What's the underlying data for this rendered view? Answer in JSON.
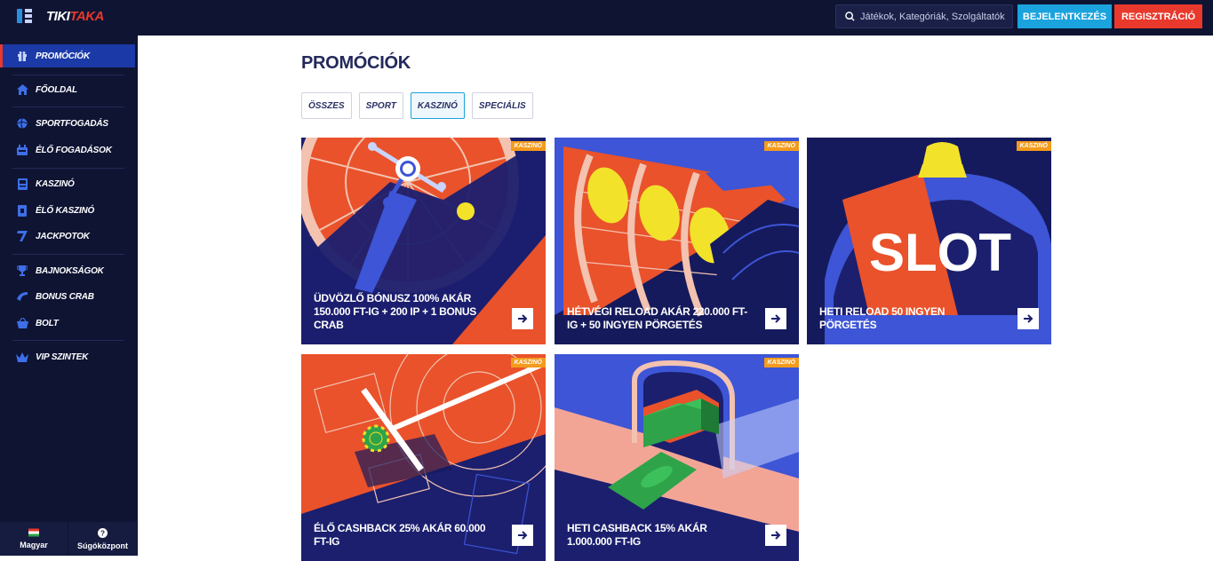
{
  "header": {
    "logo_part1": "TIKI",
    "logo_part2": "TAKA",
    "search_placeholder": "Játékok, Kategóriák, Szolgáltatók",
    "login_label": "BEJELENTKEZÉS",
    "register_label": "REGISZTRÁCIÓ"
  },
  "sidebar": {
    "items": [
      {
        "label": "PROMÓCIÓK",
        "icon": "gift-icon"
      },
      {
        "label": "FŐOLDAL",
        "icon": "home-icon"
      },
      {
        "label": "SPORTFOGADÁS",
        "icon": "ball-icon"
      },
      {
        "label": "ÉLŐ FOGADÁSOK",
        "icon": "live-icon"
      },
      {
        "label": "KASZINÓ",
        "icon": "casino-icon"
      },
      {
        "label": "ÉLŐ KASZINÓ",
        "icon": "card-icon"
      },
      {
        "label": "JACKPOTOK",
        "icon": "seven-icon"
      },
      {
        "label": "BAJNOKSÁGOK",
        "icon": "trophy-icon"
      },
      {
        "label": "BONUS CRAB",
        "icon": "crab-icon"
      },
      {
        "label": "BOLT",
        "icon": "basket-icon"
      },
      {
        "label": "VIP SZINTEK",
        "icon": "crown-icon"
      }
    ],
    "footer": {
      "language": "Magyar",
      "help": "Súgóközpont"
    }
  },
  "page": {
    "title": "PROMÓCIÓK",
    "filters": [
      "ÖSSZES",
      "SPORT",
      "KASZINÓ",
      "SPECIÁLIS"
    ],
    "active_filter": "KASZINÓ",
    "cards": [
      {
        "badge": "KASZINÓ",
        "title": "ÜDVÖZLŐ BÓNUSZ 100% AKÁR 150.000 FT-IG + 200 IP + 1 BONUS CRAB"
      },
      {
        "badge": "KASZINÓ",
        "title": "HÉTVÉGI RELOAD AKÁR 220.000 FT-IG + 50 INGYEN PÖRGETÉS"
      },
      {
        "badge": "KASZINÓ",
        "title": "HETI RELOAD 50 INGYEN PÖRGETÉS",
        "art_text": "SLOT"
      },
      {
        "badge": "KASZINÓ",
        "title": "ÉLŐ CASHBACK 25% AKÁR 60.000 FT-IG"
      },
      {
        "badge": "KASZINÓ",
        "title": "HETI CASHBACK 15% AKÁR 1.000.000 FT-IG"
      }
    ]
  },
  "colors": {
    "navy": "#0f1433",
    "accent_red": "#e8392c",
    "accent_blue": "#1aa3dd",
    "badge_orange": "#f39b1c"
  }
}
